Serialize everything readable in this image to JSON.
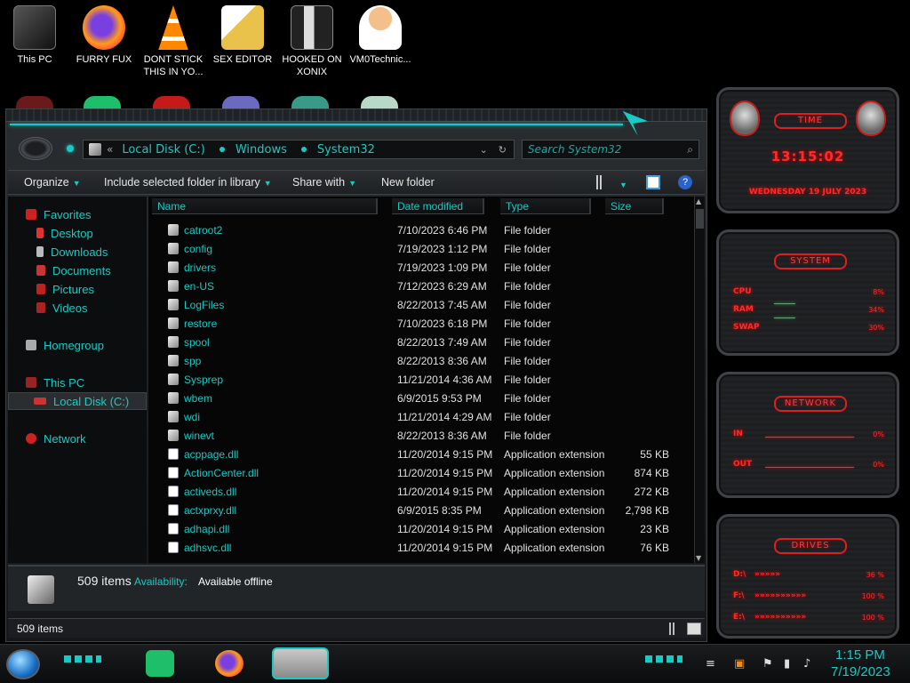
{
  "desktop": {
    "icons": [
      {
        "label": "This PC",
        "color": "#3a3a3a"
      },
      {
        "label": "FURRY FUX",
        "color": "#ff7a1a"
      },
      {
        "label": "DONT STICK THIS IN YO...",
        "color": "#ff8800"
      },
      {
        "label": "SEX EDITOR",
        "color": "#e8c24a"
      },
      {
        "label": "HOOKED ON XONIX",
        "color": "#444444"
      },
      {
        "label": "VM0Technic...",
        "color": "#f0b070"
      }
    ]
  },
  "explorer": {
    "breadcrumb": {
      "back": "«",
      "items": [
        "Local Disk (C:)",
        "Windows",
        "System32"
      ]
    },
    "search_placeholder": "Search System32",
    "toolbar": {
      "organize": "Organize",
      "include_library": "Include selected folder in library",
      "share_with": "Share with",
      "new_folder": "New folder"
    },
    "nav": {
      "favorites": "Favorites",
      "desktop": "Desktop",
      "downloads": "Downloads",
      "documents": "Documents",
      "pictures": "Pictures",
      "videos": "Videos",
      "homegroup": "Homegroup",
      "this_pc": "This PC",
      "local_disk": "Local Disk (C:)",
      "network": "Network"
    },
    "columns": {
      "name": "Name",
      "date": "Date modified",
      "type": "Type",
      "size": "Size"
    },
    "files": [
      {
        "name": "catroot2",
        "date": "7/10/2023 6:46 PM",
        "type": "File folder",
        "size": "",
        "kind": "folder"
      },
      {
        "name": "config",
        "date": "7/19/2023 1:12 PM",
        "type": "File folder",
        "size": "",
        "kind": "folder"
      },
      {
        "name": "drivers",
        "date": "7/19/2023 1:09 PM",
        "type": "File folder",
        "size": "",
        "kind": "folder"
      },
      {
        "name": "en-US",
        "date": "7/12/2023 6:29 AM",
        "type": "File folder",
        "size": "",
        "kind": "folder"
      },
      {
        "name": "LogFiles",
        "date": "8/22/2013 7:45 AM",
        "type": "File folder",
        "size": "",
        "kind": "folder"
      },
      {
        "name": "restore",
        "date": "7/10/2023 6:18 PM",
        "type": "File folder",
        "size": "",
        "kind": "folder"
      },
      {
        "name": "spool",
        "date": "8/22/2013 7:49 AM",
        "type": "File folder",
        "size": "",
        "kind": "folder"
      },
      {
        "name": "spp",
        "date": "8/22/2013 8:36 AM",
        "type": "File folder",
        "size": "",
        "kind": "folder"
      },
      {
        "name": "Sysprep",
        "date": "11/21/2014 4:36 AM",
        "type": "File folder",
        "size": "",
        "kind": "folder"
      },
      {
        "name": "wbem",
        "date": "6/9/2015 9:53 PM",
        "type": "File folder",
        "size": "",
        "kind": "folder"
      },
      {
        "name": "wdi",
        "date": "11/21/2014 4:29 AM",
        "type": "File folder",
        "size": "",
        "kind": "folder"
      },
      {
        "name": "winevt",
        "date": "8/22/2013 8:36 AM",
        "type": "File folder",
        "size": "",
        "kind": "folder"
      },
      {
        "name": "acppage.dll",
        "date": "11/20/2014 9:15 PM",
        "type": "Application extension",
        "size": "55 KB",
        "kind": "file"
      },
      {
        "name": "ActionCenter.dll",
        "date": "11/20/2014 9:15 PM",
        "type": "Application extension",
        "size": "874 KB",
        "kind": "file"
      },
      {
        "name": "activeds.dll",
        "date": "11/20/2014 9:15 PM",
        "type": "Application extension",
        "size": "272 KB",
        "kind": "file"
      },
      {
        "name": "actxprxy.dll",
        "date": "6/9/2015 8:35 PM",
        "type": "Application extension",
        "size": "2,798 KB",
        "kind": "file"
      },
      {
        "name": "adhapi.dll",
        "date": "11/20/2014 9:15 PM",
        "type": "Application extension",
        "size": "23 KB",
        "kind": "file"
      },
      {
        "name": "adhsvc.dll",
        "date": "11/20/2014 9:15 PM",
        "type": "Application extension",
        "size": "76 KB",
        "kind": "file"
      }
    ],
    "details": {
      "count": "509 items",
      "availability_label": "Availability:",
      "availability_value": "Available offline"
    },
    "status": "509 items"
  },
  "gadget": {
    "time_title": "TIME",
    "time": "13:15:02",
    "date": "WEDNESDAY 19 JULY 2023",
    "system_title": "SYSTEM",
    "cpu_label": "CPU",
    "cpu_value": "8%",
    "ram_label": "RAM",
    "ram_value": "34%",
    "swap_label": "SWAP",
    "swap_value": "30%",
    "network_title": "NETWORK",
    "in_label": "IN",
    "in_value": "0%",
    "out_label": "OUT",
    "out_value": "0%",
    "drives_title": "DRIVES",
    "drive1": "D:\\",
    "drive1_value": "36 %",
    "drive2": "F:\\",
    "drive2_value": "100 %",
    "drive3": "E:\\",
    "drive3_value": "100 %"
  },
  "taskbar": {
    "time": "1:15 PM",
    "date": "7/19/2023"
  },
  "colors": {
    "accent": "#19c9c4",
    "gadget_red": "#ff2a2a"
  }
}
